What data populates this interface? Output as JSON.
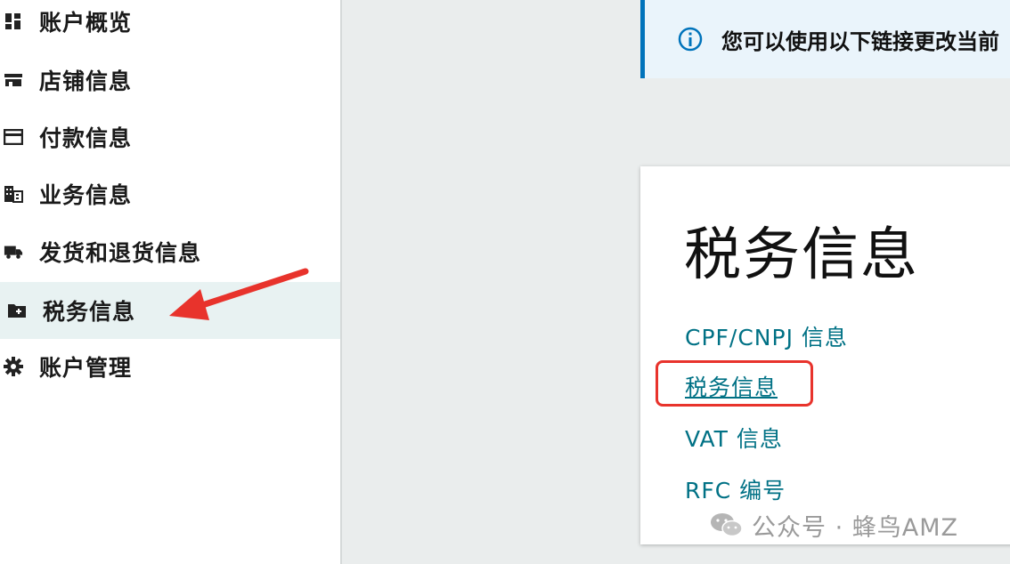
{
  "sidebar": {
    "items": [
      {
        "label": "账户概览",
        "icon": "dashboard-icon"
      },
      {
        "label": "店铺信息",
        "icon": "store-icon"
      },
      {
        "label": "付款信息",
        "icon": "credit-card-icon"
      },
      {
        "label": "业务信息",
        "icon": "building-icon"
      },
      {
        "label": "发货和退货信息",
        "icon": "truck-icon"
      },
      {
        "label": "税务信息",
        "icon": "folder-plus-icon",
        "active": true
      },
      {
        "label": "账户管理",
        "icon": "gear-icon"
      }
    ]
  },
  "banner": {
    "text": "您可以使用以下链接更改当前"
  },
  "card": {
    "title": "税务信息",
    "links": [
      {
        "label": "CPF/CNPJ 信息"
      },
      {
        "label": "税务信息",
        "underlined": true
      },
      {
        "label": "VAT 信息"
      },
      {
        "label": "RFC 编号"
      }
    ]
  },
  "watermark": {
    "text": "公众号 · 蜂鸟AMZ"
  },
  "colors": {
    "link": "#007185",
    "accent_border": "#0073bb",
    "annotation_red": "#e8332c",
    "active_bg": "#e8f2f2"
  }
}
